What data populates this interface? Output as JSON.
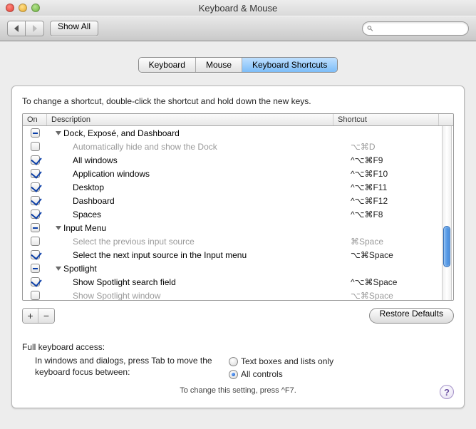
{
  "window": {
    "title": "Keyboard & Mouse"
  },
  "toolbar": {
    "show_all": "Show All",
    "search_placeholder": ""
  },
  "tabs": [
    "Keyboard",
    "Mouse",
    "Keyboard Shortcuts"
  ],
  "active_tab": 2,
  "instruction": "To change a shortcut, double-click the shortcut and hold down the new keys.",
  "columns": {
    "on": "On",
    "description": "Description",
    "shortcut": "Shortcut"
  },
  "rows": [
    {
      "type": "group",
      "state": "mixed",
      "indent": 0,
      "label": "Dock, Exposé, and Dashboard",
      "shortcut": ""
    },
    {
      "type": "item",
      "state": "off",
      "indent": 1,
      "label": "Automatically hide and show the Dock",
      "shortcut": "⌥⌘D",
      "disabled": true
    },
    {
      "type": "item",
      "state": "on",
      "indent": 1,
      "label": "All windows",
      "shortcut": "^⌥⌘F9"
    },
    {
      "type": "item",
      "state": "on",
      "indent": 1,
      "label": "Application windows",
      "shortcut": "^⌥⌘F10"
    },
    {
      "type": "item",
      "state": "on",
      "indent": 1,
      "label": "Desktop",
      "shortcut": "^⌥⌘F11"
    },
    {
      "type": "item",
      "state": "on",
      "indent": 1,
      "label": "Dashboard",
      "shortcut": "^⌥⌘F12"
    },
    {
      "type": "item",
      "state": "on",
      "indent": 1,
      "label": "Spaces",
      "shortcut": "^⌥⌘F8"
    },
    {
      "type": "group",
      "state": "mixed",
      "indent": 0,
      "label": "Input Menu",
      "shortcut": ""
    },
    {
      "type": "item",
      "state": "off",
      "indent": 1,
      "label": "Select the previous input source",
      "shortcut": "⌘Space",
      "disabled": true
    },
    {
      "type": "item",
      "state": "on",
      "indent": 1,
      "label": "Select the next input source in the Input menu",
      "shortcut": "⌥⌘Space"
    },
    {
      "type": "group",
      "state": "mixed",
      "indent": 0,
      "label": "Spotlight",
      "shortcut": ""
    },
    {
      "type": "item",
      "state": "on",
      "indent": 1,
      "label": "Show Spotlight search field",
      "shortcut": "^⌥⌘Space"
    },
    {
      "type": "item",
      "state": "off",
      "indent": 1,
      "label": "Show Spotlight window",
      "shortcut": "⌥⌘Space",
      "disabled": true
    }
  ],
  "buttons": {
    "add": "+",
    "remove": "−",
    "restore": "Restore Defaults"
  },
  "access": {
    "heading": "Full keyboard access:",
    "desc": "In windows and dialogs, press Tab to move the keyboard focus between:",
    "opt1": "Text boxes and lists only",
    "opt2": "All controls",
    "selected": 1,
    "hint": "To change this setting, press ^F7."
  },
  "help": "?"
}
